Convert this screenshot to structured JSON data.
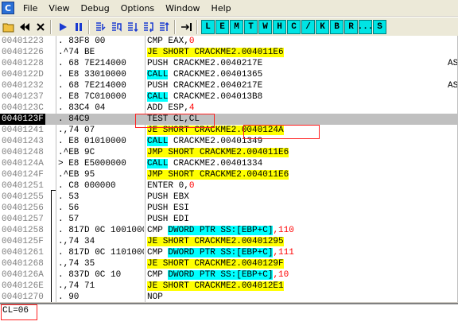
{
  "app": {
    "icon_letter": "C"
  },
  "menu": [
    "File",
    "View",
    "Debug",
    "Options",
    "Window",
    "Help"
  ],
  "toolbar": {
    "icons": [
      "open-icon",
      "rewind-icon",
      "close-icon",
      "run-icon",
      "pause-icon",
      "step-into-icon",
      "step-over-icon",
      "trace-into-icon",
      "trace-over-icon",
      "execute-till-return-icon",
      "goto-icon"
    ],
    "letter_buttons": [
      "L",
      "E",
      "M",
      "T",
      "W",
      "H",
      "C",
      "/",
      "K",
      "B",
      "R",
      "...",
      "S"
    ]
  },
  "rows": [
    {
      "addr": "00401223",
      "hex": ". 83F8 00",
      "segments": [
        {
          "t": "CMP EAX,",
          "c": ""
        },
        {
          "t": "0",
          "c": "red"
        }
      ],
      "comment": ""
    },
    {
      "addr": "00401226",
      "hex": ".^74 BE",
      "segments": [
        {
          "t": "JE SHORT CRACKME2.004011E6",
          "c": "y"
        }
      ],
      "comment": ""
    },
    {
      "addr": "00401228",
      "hex": ". 68 7E214000",
      "segments": [
        {
          "t": "PUSH CRACKME2.0040217E",
          "c": ""
        }
      ],
      "comment": "AS"
    },
    {
      "addr": "0040122D",
      "hex": ". E8 33010000",
      "segments": [
        {
          "t": "CALL",
          "c": "c"
        },
        {
          "t": " CRACKME2.00401365",
          "c": ""
        }
      ],
      "comment": ""
    },
    {
      "addr": "00401232",
      "hex": ". 68 7E214000",
      "segments": [
        {
          "t": "PUSH CRACKME2.0040217E",
          "c": ""
        }
      ],
      "comment": "AS"
    },
    {
      "addr": "00401237",
      "hex": ". E8 7C010000",
      "segments": [
        {
          "t": "CALL",
          "c": "c"
        },
        {
          "t": " CRACKME2.004013B8",
          "c": ""
        }
      ],
      "comment": ""
    },
    {
      "addr": "0040123C",
      "hex": ". 83C4 04",
      "segments": [
        {
          "t": "ADD ESP,",
          "c": ""
        },
        {
          "t": "4",
          "c": "red"
        }
      ],
      "comment": ""
    },
    {
      "addr": "0040123F",
      "hex": ". 84C9",
      "segments": [
        {
          "t": "TEST CL,CL",
          "c": ""
        }
      ],
      "comment": "",
      "selected": true
    },
    {
      "addr": "00401241",
      "hex": ".,74 07",
      "segments": [
        {
          "t": "JE SHORT CRACKME2.0040124A",
          "c": "y"
        }
      ],
      "comment": ""
    },
    {
      "addr": "00401243",
      "hex": ". E8 01010000",
      "segments": [
        {
          "t": "CALL",
          "c": "c"
        },
        {
          "t": " CRACKME2.00401349",
          "c": ""
        }
      ],
      "comment": ""
    },
    {
      "addr": "00401248",
      "hex": ".^EB 9C",
      "segments": [
        {
          "t": "JMP SHORT CRACKME2.004011E6",
          "c": "y"
        }
      ],
      "comment": ""
    },
    {
      "addr": "0040124A",
      "hex": "> E8 E5000000",
      "segments": [
        {
          "t": "CALL",
          "c": "c"
        },
        {
          "t": " CRACKME2.00401334",
          "c": ""
        }
      ],
      "comment": ""
    },
    {
      "addr": "0040124F",
      "hex": ".^EB 95",
      "segments": [
        {
          "t": "JMP SHORT CRACKME2.004011E6",
          "c": "y"
        }
      ],
      "comment": ""
    },
    {
      "addr": "00401251",
      "hex": ". C8 000000",
      "segments": [
        {
          "t": "ENTER 0,",
          "c": ""
        },
        {
          "t": "0",
          "c": "red"
        }
      ],
      "comment": ""
    },
    {
      "addr": "00401255",
      "hex": ". 53",
      "segments": [
        {
          "t": "PUSH EBX",
          "c": ""
        }
      ],
      "comment": ""
    },
    {
      "addr": "00401256",
      "hex": ". 56",
      "segments": [
        {
          "t": "PUSH ESI",
          "c": ""
        }
      ],
      "comment": ""
    },
    {
      "addr": "00401257",
      "hex": ". 57",
      "segments": [
        {
          "t": "PUSH EDI",
          "c": ""
        }
      ],
      "comment": ""
    },
    {
      "addr": "00401258",
      "hex": ". 817D 0C 1001000",
      "segments": [
        {
          "t": "CMP ",
          "c": ""
        },
        {
          "t": "DWORD PTR SS:[EBP+C]",
          "c": "c"
        },
        {
          "t": ",110",
          "c": "red"
        }
      ],
      "comment": ""
    },
    {
      "addr": "0040125F",
      "hex": ".,74 34",
      "segments": [
        {
          "t": "JE SHORT CRACKME2.00401295",
          "c": "y"
        }
      ],
      "comment": ""
    },
    {
      "addr": "00401261",
      "hex": ". 817D 0C 1101000",
      "segments": [
        {
          "t": "CMP ",
          "c": ""
        },
        {
          "t": "DWORD PTR SS:[EBP+C]",
          "c": "c"
        },
        {
          "t": ",111",
          "c": "red"
        }
      ],
      "comment": ""
    },
    {
      "addr": "00401268",
      "hex": ".,74 35",
      "segments": [
        {
          "t": "JE SHORT CRACKME2.0040129F",
          "c": "y"
        }
      ],
      "comment": ""
    },
    {
      "addr": "0040126A",
      "hex": ". 837D 0C 10",
      "segments": [
        {
          "t": "CMP ",
          "c": ""
        },
        {
          "t": "DWORD PTR SS:[EBP+C]",
          "c": "c"
        },
        {
          "t": ",10",
          "c": "red"
        }
      ],
      "comment": ""
    },
    {
      "addr": "0040126E",
      "hex": ".,74 71",
      "segments": [
        {
          "t": "JE SHORT CRACKME2.004012E1",
          "c": "y"
        }
      ],
      "comment": ""
    },
    {
      "addr": "00401270",
      "hex": ". 90",
      "segments": [
        {
          "t": "NOP",
          "c": ""
        }
      ],
      "comment": ""
    }
  ],
  "info": {
    "text": "CL=06"
  }
}
